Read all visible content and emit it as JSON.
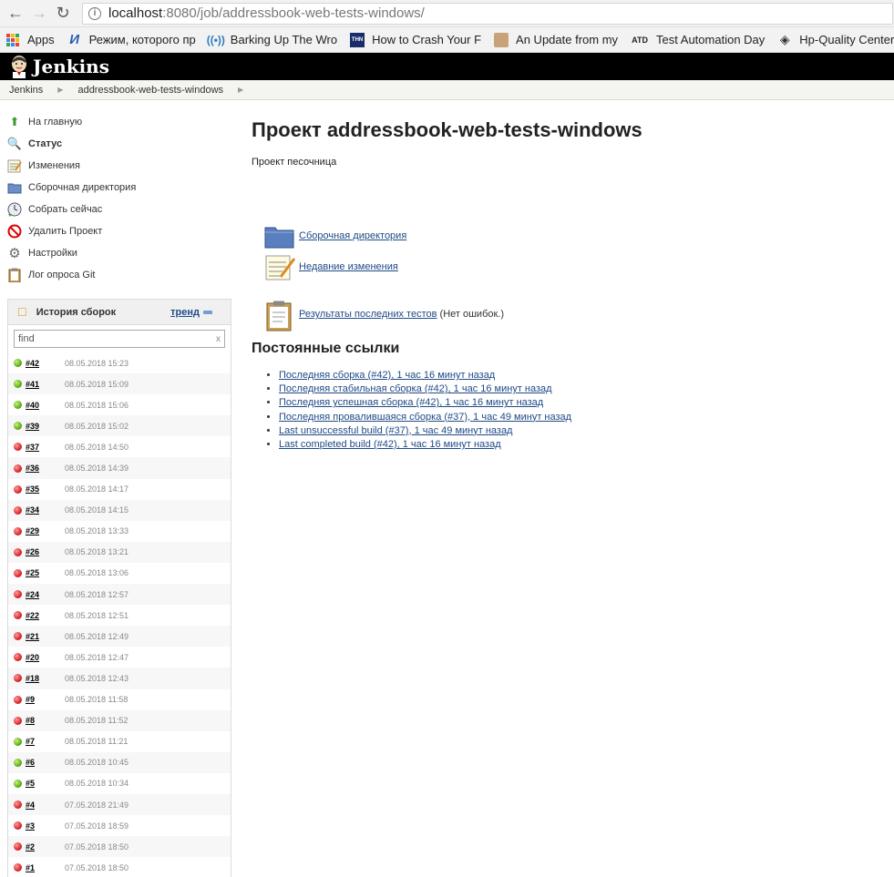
{
  "browser": {
    "url_host": "localhost",
    "url_rest": ":8080/job/addressbook-web-tests-windows/",
    "bookmarks": [
      {
        "label": "Apps",
        "icon": "apps-grid-icon"
      },
      {
        "label": "Режим, которого пр",
        "icon": "bookmark-icon"
      },
      {
        "label": "Barking Up The Wro",
        "icon": "wifi-icon"
      },
      {
        "label": "How to Crash Your F",
        "icon": "thn-icon",
        "badge": "THN"
      },
      {
        "label": "An Update from my",
        "icon": "avatar-icon"
      },
      {
        "label": "Test Automation Day",
        "icon": "atd-icon",
        "badge": "ATD"
      },
      {
        "label": "Hp-Quality Center Tu",
        "icon": "diamond-icon"
      }
    ]
  },
  "header": {
    "title": "Jenkins"
  },
  "breadcrumb": {
    "root": "Jenkins",
    "job": "addressbook-web-tests-windows"
  },
  "sidebar": {
    "tasks": [
      {
        "label": "На главную",
        "icon": "up-arrow-icon"
      },
      {
        "label": "Статус",
        "icon": "search-icon"
      },
      {
        "label": "Изменения",
        "icon": "notepad-icon"
      },
      {
        "label": "Сборочная директория",
        "icon": "folder-icon"
      },
      {
        "label": "Собрать сейчас",
        "icon": "clock-icon"
      },
      {
        "label": "Удалить Проект",
        "icon": "no-entry-icon"
      },
      {
        "label": "Настройки",
        "icon": "gear-icon"
      },
      {
        "label": "Лог опроса Git",
        "icon": "clipboard-icon"
      }
    ]
  },
  "history": {
    "title": "История сборок",
    "trend": "тренд",
    "search_value": "find",
    "builds": [
      {
        "num": "#42",
        "date": "08.05.2018 15:23",
        "status": "blue"
      },
      {
        "num": "#41",
        "date": "08.05.2018 15:09",
        "status": "blue"
      },
      {
        "num": "#40",
        "date": "08.05.2018 15:06",
        "status": "blue"
      },
      {
        "num": "#39",
        "date": "08.05.2018 15:02",
        "status": "blue"
      },
      {
        "num": "#37",
        "date": "08.05.2018 14:50",
        "status": "red"
      },
      {
        "num": "#36",
        "date": "08.05.2018 14:39",
        "status": "red"
      },
      {
        "num": "#35",
        "date": "08.05.2018 14:17",
        "status": "red"
      },
      {
        "num": "#34",
        "date": "08.05.2018 14:15",
        "status": "red"
      },
      {
        "num": "#29",
        "date": "08.05.2018 13:33",
        "status": "red"
      },
      {
        "num": "#26",
        "date": "08.05.2018 13:21",
        "status": "red"
      },
      {
        "num": "#25",
        "date": "08.05.2018 13:06",
        "status": "red"
      },
      {
        "num": "#24",
        "date": "08.05.2018 12:57",
        "status": "red"
      },
      {
        "num": "#22",
        "date": "08.05.2018 12:51",
        "status": "red"
      },
      {
        "num": "#21",
        "date": "08.05.2018 12:49",
        "status": "red"
      },
      {
        "num": "#20",
        "date": "08.05.2018 12:47",
        "status": "red"
      },
      {
        "num": "#18",
        "date": "08.05.2018 12:43",
        "status": "red"
      },
      {
        "num": "#9",
        "date": "08.05.2018 11:58",
        "status": "red"
      },
      {
        "num": "#8",
        "date": "08.05.2018 11:52",
        "status": "red"
      },
      {
        "num": "#7",
        "date": "08.05.2018 11:21",
        "status": "blue"
      },
      {
        "num": "#6",
        "date": "08.05.2018 10:45",
        "status": "blue"
      },
      {
        "num": "#5",
        "date": "08.05.2018 10:34",
        "status": "blue"
      },
      {
        "num": "#4",
        "date": "07.05.2018 21:49",
        "status": "red"
      },
      {
        "num": "#3",
        "date": "07.05.2018 18:59",
        "status": "red"
      },
      {
        "num": "#2",
        "date": "07.05.2018 18:50",
        "status": "red"
      },
      {
        "num": "#1",
        "date": "07.05.2018 18:50",
        "status": "red"
      }
    ]
  },
  "main": {
    "title": "Проект addressbook-web-tests-windows",
    "description": "Проект песочница",
    "actions": {
      "workspace": "Сборочная директория",
      "changes": "Недавние изменения",
      "test_results": "Результаты последних тестов",
      "test_results_suffix": " (Нет ошибок.)"
    },
    "permalinks_title": "Постоянные ссылки",
    "permalinks": [
      "Последняя сборка (#42), 1 час 16 минут назад",
      "Последняя стабильная сборка (#42), 1 час 16 минут назад",
      "Последняя успешная сборка (#42), 1 час 16 минут назад",
      "Последняя провалившаяся сборка (#37), 1 час 49 минут назад",
      "Last unsuccessful build (#37), 1 час 49 минут назад",
      "Last completed build (#42), 1 час 16 минут назад"
    ]
  },
  "colors": {
    "link": "#204a87",
    "success": "#4fa30a",
    "failure": "#d2171b",
    "header_bg": "#000000"
  }
}
